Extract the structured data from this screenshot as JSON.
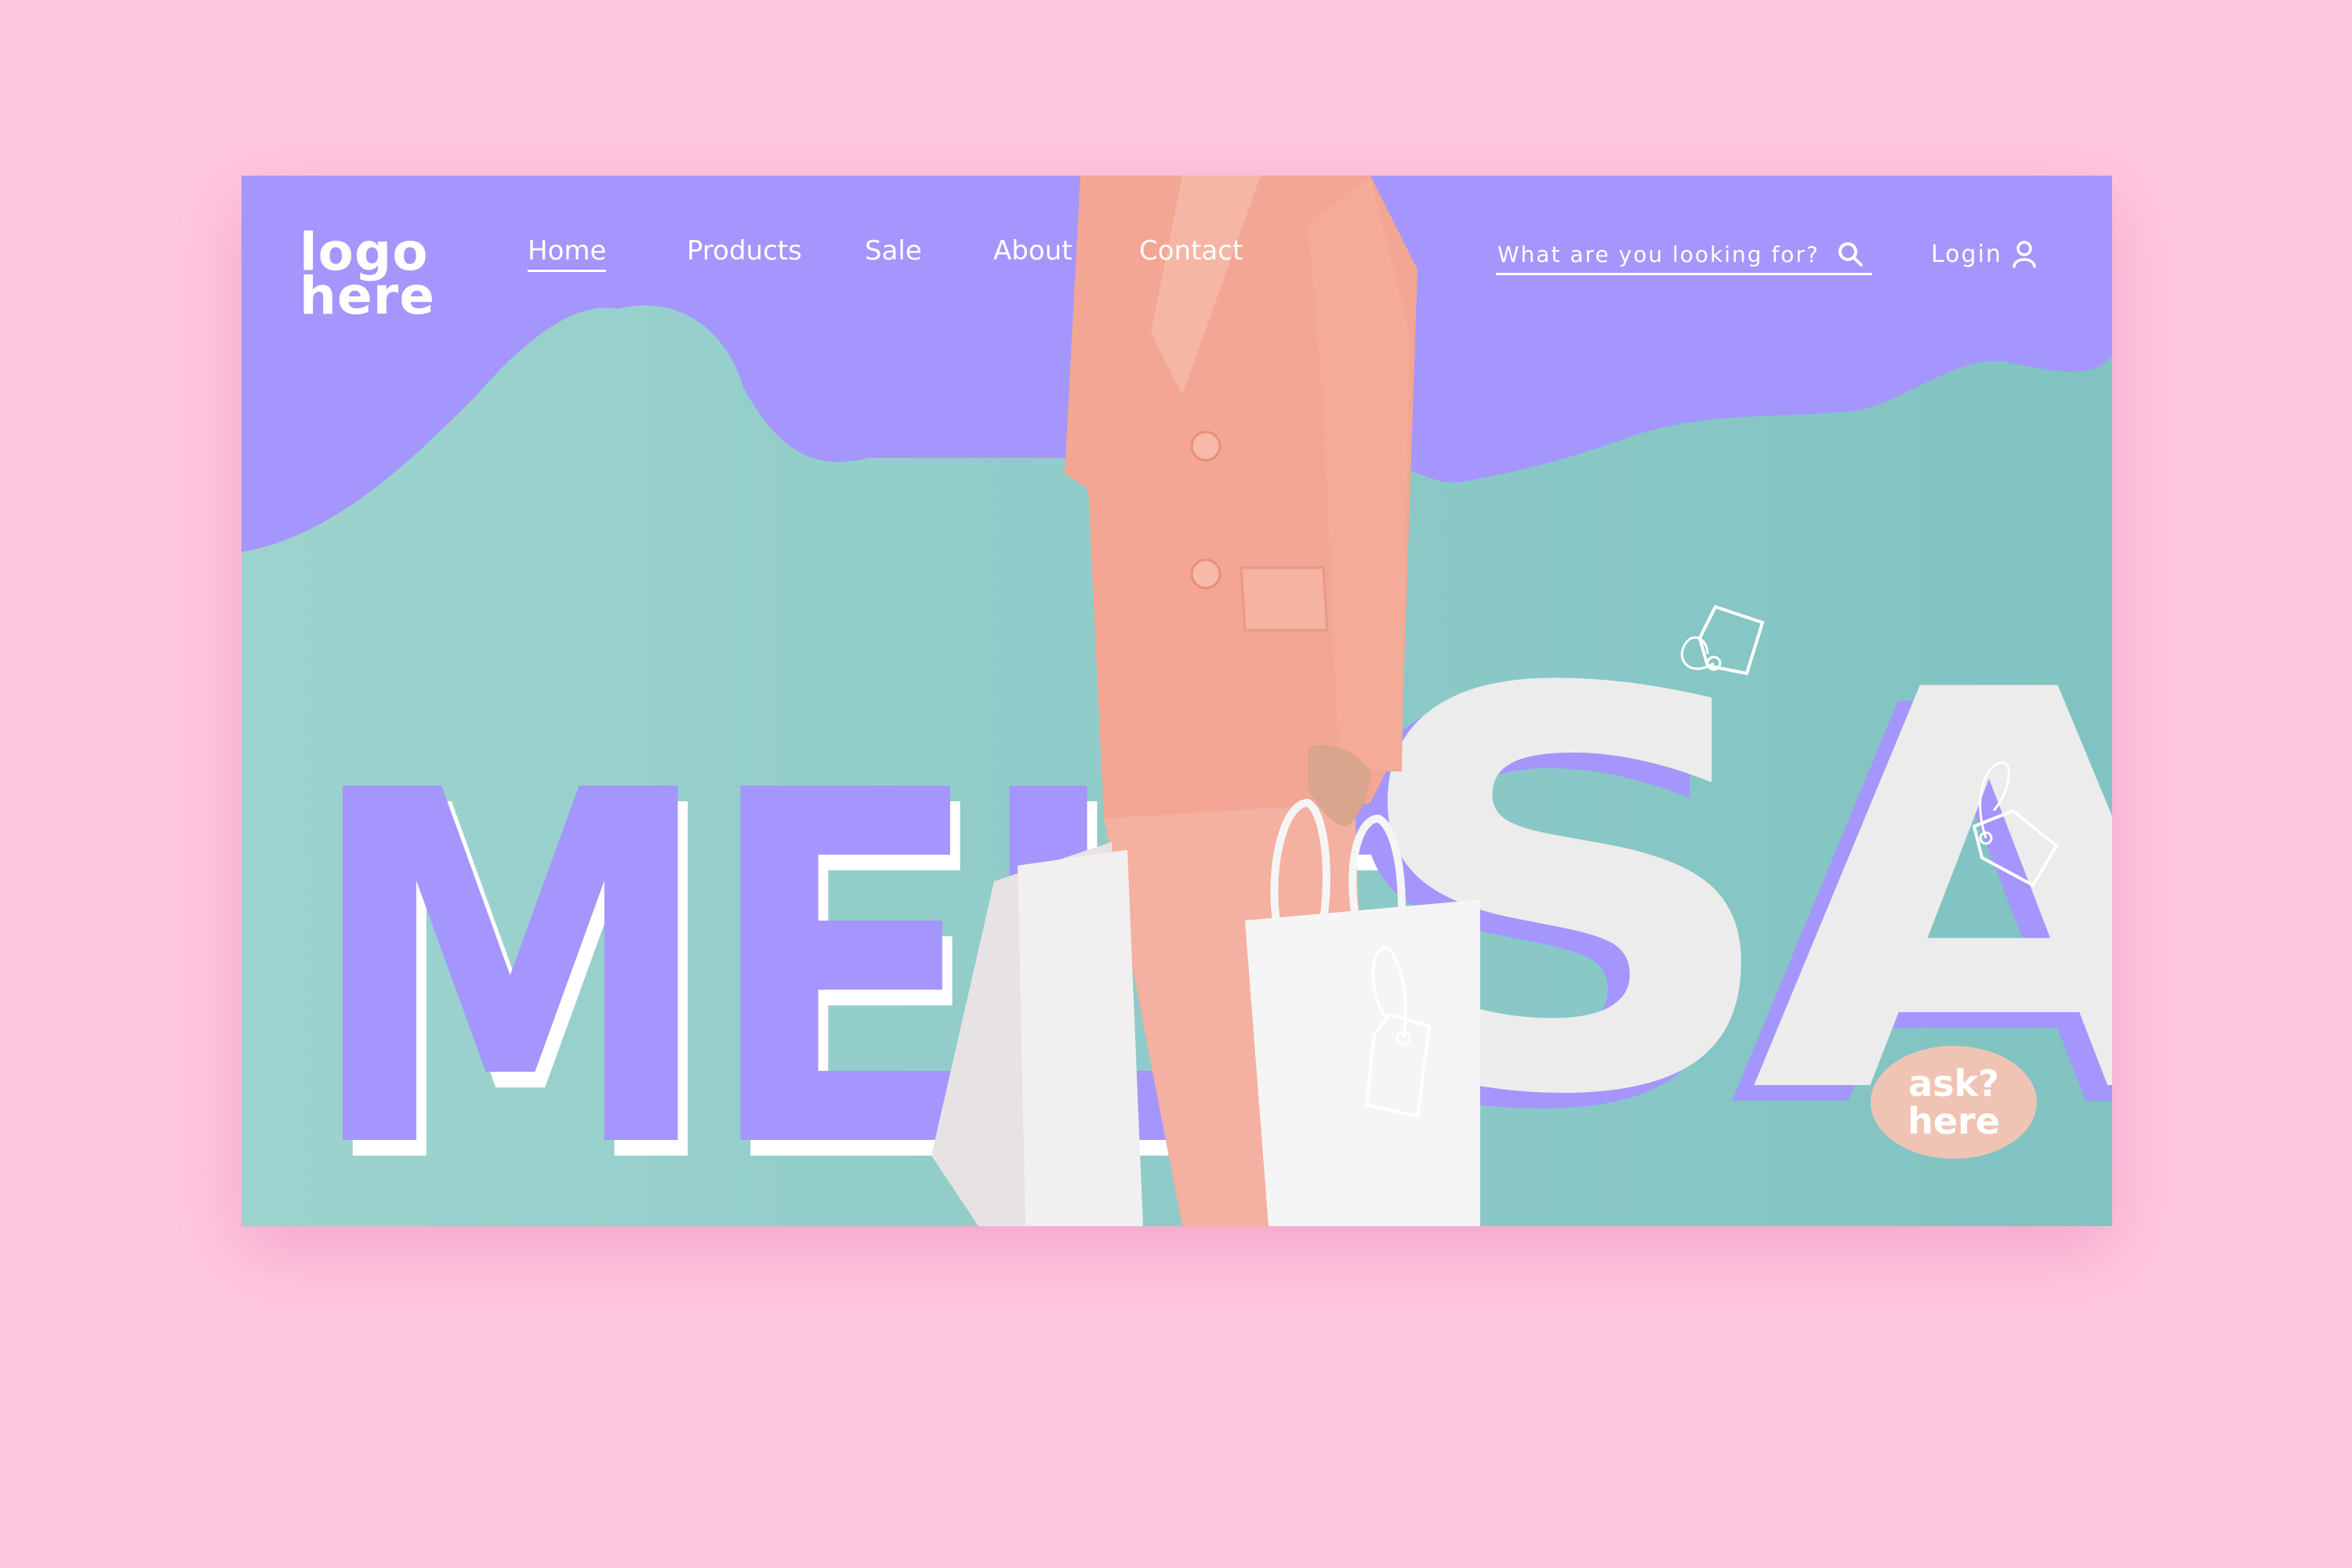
{
  "logo": {
    "line1": "logo",
    "line2": "here"
  },
  "nav": {
    "items": [
      {
        "label": "Home",
        "active": true
      },
      {
        "label": "Products",
        "active": false
      },
      {
        "label": "Sale",
        "active": false
      },
      {
        "label": "About",
        "active": false
      },
      {
        "label": "Contact",
        "active": false
      }
    ]
  },
  "search": {
    "placeholder": "What are you looking for?"
  },
  "login": {
    "label": "Login"
  },
  "hero": {
    "word1": "MELT",
    "word2": "SALE"
  },
  "ask": {
    "line1": "ask?",
    "line2": "here"
  },
  "colors": {
    "page_bg": "#ffc8e0",
    "purple": "#a496fc",
    "mint": "#8ecac6",
    "peach": "#f3a693",
    "badge": "#f0c4b4",
    "white": "#ffffff"
  },
  "icons": [
    "search-icon",
    "user-icon",
    "price-tag-icon"
  ]
}
